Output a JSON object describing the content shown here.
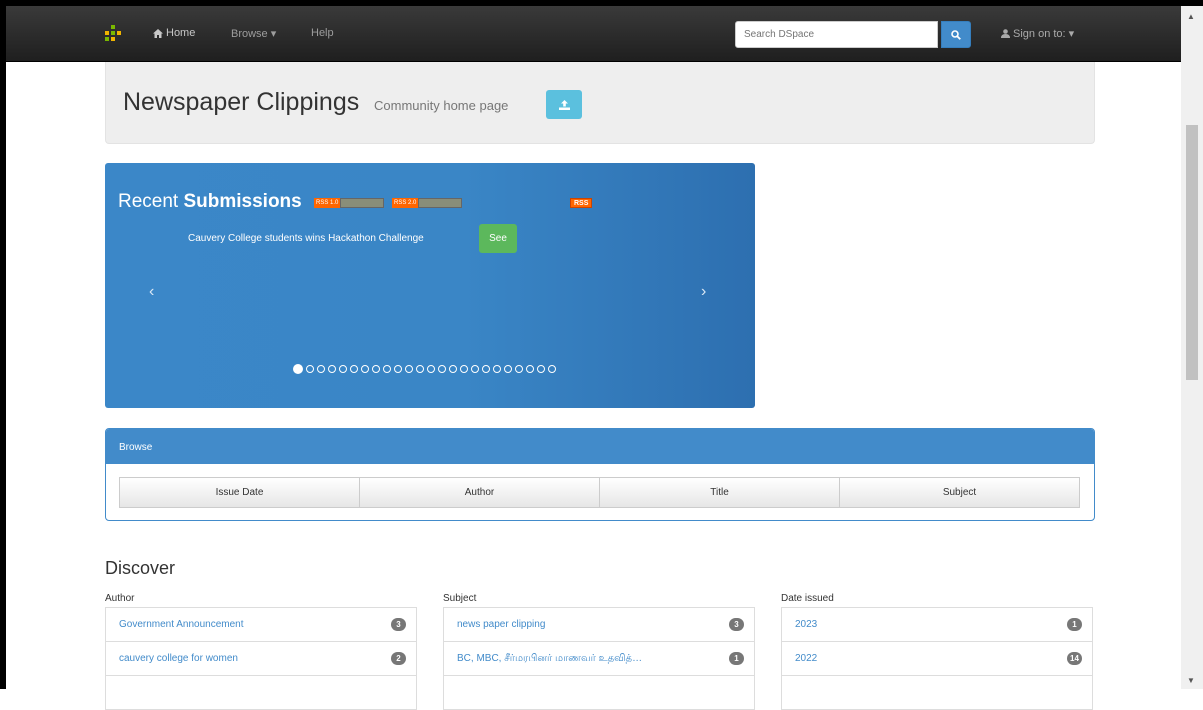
{
  "navbar": {
    "home_label": "Home",
    "browse_label": "Browse",
    "help_label": "Help",
    "search_placeholder": "Search DSpace",
    "signon_label": "Sign on to:"
  },
  "header": {
    "title": "Newspaper Clippings",
    "subtitle": "Community home page"
  },
  "carousel": {
    "title_plain": "Recent",
    "title_bold": "Submissions",
    "feed_label": "RSS",
    "caption": "Cauvery College students wins Hackathon Challenge",
    "see_label": "See"
  },
  "browse": {
    "heading": "Browse",
    "buttons": [
      "Issue Date",
      "Author",
      "Title",
      "Subject"
    ]
  },
  "discover": {
    "title": "Discover",
    "facets": [
      {
        "label": "Author",
        "items": [
          {
            "text": "Government Announcement",
            "count": "3"
          },
          {
            "text": "cauvery college for women",
            "count": "2"
          }
        ]
      },
      {
        "label": "Subject",
        "items": [
          {
            "text": "news paper clipping",
            "count": "3"
          },
          {
            "text": "BC, MBC, சீர்மரபினர் மாணவர் உதவித்…",
            "count": "1"
          }
        ]
      },
      {
        "label": "Date issued",
        "items": [
          {
            "text": "2023",
            "count": "1"
          },
          {
            "text": "2022",
            "count": "14"
          }
        ]
      }
    ]
  },
  "colors": {
    "navbar": "#222222",
    "primary": "#428bca",
    "success": "#5cb85c",
    "info": "#5bc0de"
  }
}
